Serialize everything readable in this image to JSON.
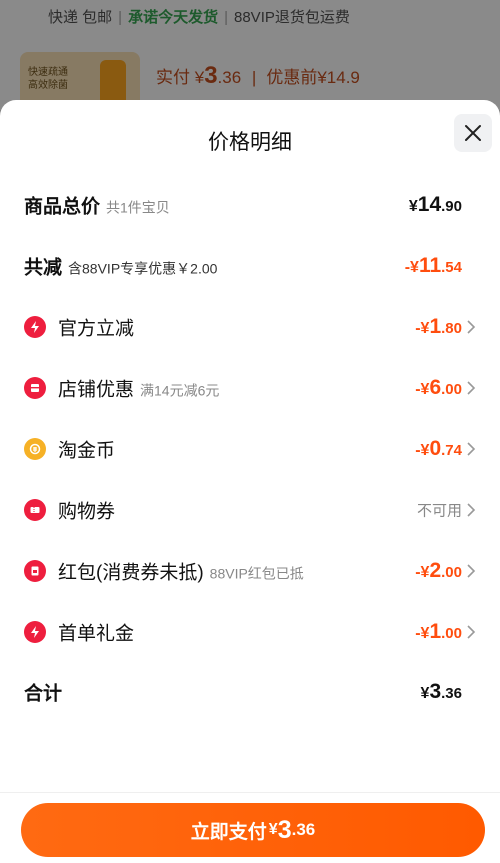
{
  "background": {
    "shipping": {
      "free": "快递 包邮",
      "promise": "承诺今天发货",
      "returns": "88VIP退货包运费"
    },
    "thumb_text": [
      "快速疏通",
      "高效除菌"
    ],
    "pay_label": "实付 ¥",
    "pay_int": "3",
    "pay_dec": ".36",
    "orig_price": "优惠前¥14.9"
  },
  "sheet": {
    "title": "价格明细",
    "rows": [
      {
        "label": "商品总价",
        "sub": "共1件宝贝",
        "pre": "¥",
        "int": "14",
        "dec": ".90"
      },
      {
        "label": "共减",
        "sub": "含88VIP专享优惠￥2.00",
        "pre": "-¥",
        "int": "11",
        "dec": ".54"
      },
      {
        "label": "官方立减",
        "icon": "lightning-icon",
        "pre": "-¥",
        "int": "1",
        "dec": ".80"
      },
      {
        "label": "店铺优惠",
        "icon": "shop-icon",
        "sub": "满14元减6元",
        "pre": "-¥",
        "int": "6",
        "dec": ".00"
      },
      {
        "label": "淘金币",
        "icon": "taojinbi-coin-icon",
        "pre": "-¥",
        "int": "0",
        "dec": ".74"
      },
      {
        "label": "购物券",
        "icon": "coupon-icon",
        "status": "不可用"
      },
      {
        "label": "红包(消费券未抵)",
        "icon": "red-envelope-icon",
        "sub": "88VIP红包已抵",
        "pre": "-¥",
        "int": "2",
        "dec": ".00"
      },
      {
        "label": "首单礼金",
        "icon": "lightning-icon",
        "pre": "-¥",
        "int": "1",
        "dec": ".00"
      },
      {
        "label": "合计",
        "pre": "¥",
        "int": "3",
        "dec": ".36"
      }
    ]
  },
  "pay_button": {
    "label": "立即支付",
    "pre": "¥",
    "int": "3",
    "dec": ".36"
  },
  "colors": {
    "accent": "#ff5a00",
    "icon_red": "#ee1e3e",
    "icon_gold": "#f6b126",
    "price_orange": "#ff4d0e"
  }
}
